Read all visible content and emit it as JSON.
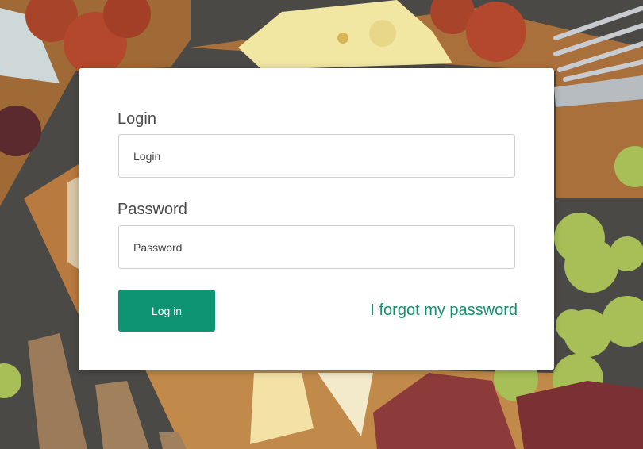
{
  "form": {
    "login_label": "Login",
    "login_placeholder": "Login",
    "password_label": "Password",
    "password_placeholder": "Password",
    "submit_label": "Log in",
    "forgot_link": "I forgot my password"
  },
  "colors": {
    "accent": "#0f9473",
    "link": "#12906f",
    "card": "#ffffff"
  }
}
